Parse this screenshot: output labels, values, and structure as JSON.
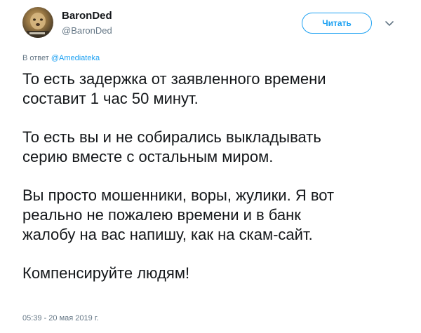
{
  "author": {
    "display_name": "BaronDed",
    "screen_name": "@BaronDed",
    "avatar_icon": "avatar-photo"
  },
  "actions": {
    "follow_label": "Читать",
    "more_icon": "chevron-down-icon"
  },
  "reply": {
    "prefix": "В ответ",
    "handle": "@Amediateka"
  },
  "tweet": {
    "paragraphs": [
      "То есть задержка от заявленного времени\nсоставит 1 час 50 минут.",
      "То есть вы и не собирались выкладывать\nсерию вместе с остальным миром.",
      "Вы просто мошенники, воры, жулики. Я вот\nреально не пожалею времени и в банк\nжалобу на вас напишу, как на скам-сайт.",
      "Компенсируйте людям!"
    ],
    "timestamp": "05:39 - 20 мая 2019 г."
  },
  "colors": {
    "accent": "#1da1f2",
    "secondary_text": "#657786",
    "primary_text": "#14171a"
  }
}
